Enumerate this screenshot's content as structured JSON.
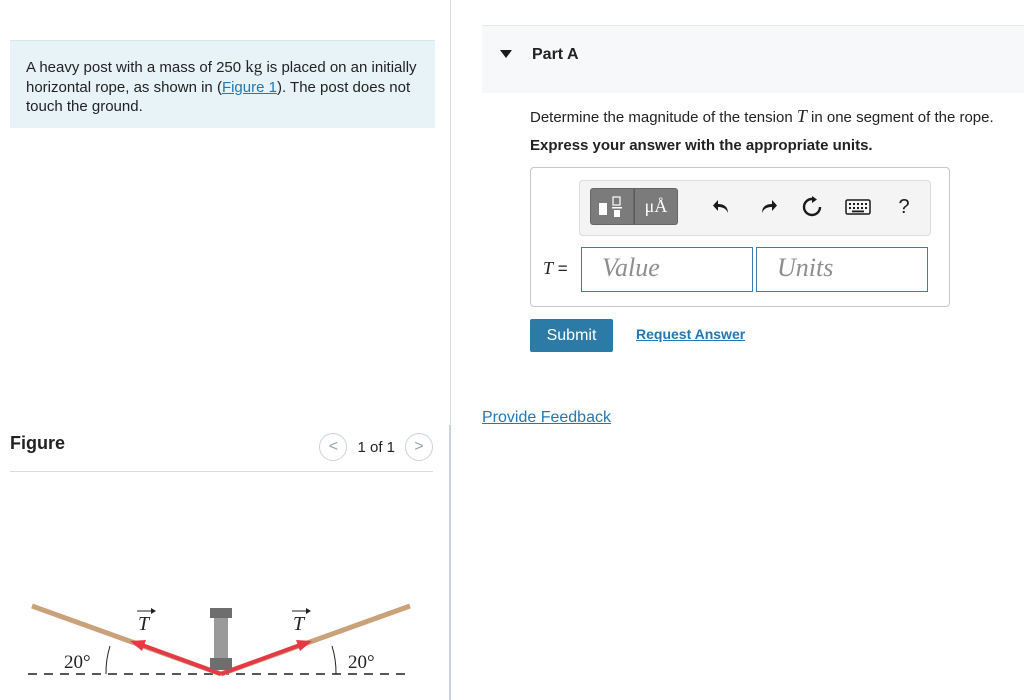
{
  "problem": {
    "text_before_mass": "A heavy post with a mass of 250 ",
    "mass_unit": "kg",
    "text_after_mass": " is placed on an initially horizontal rope, as shown in (",
    "figure_link": "Figure 1",
    "text_end": "). The post does not touch the ground."
  },
  "figure": {
    "title": "Figure",
    "pager_text": "1 of 1",
    "prev_symbol": "<",
    "next_symbol": ">",
    "angle_left": "20°",
    "angle_right": "20°",
    "vector_left": "T",
    "vector_right": "T",
    "colors": {
      "rope": "#c9a27a",
      "vector": "#e63946",
      "post": "#7d7d7d"
    }
  },
  "part": {
    "title": "Part A",
    "question_before": "Determine the magnitude of the tension ",
    "question_symbol": "T",
    "question_after": " in one segment of the rope.",
    "instruction": "Express your answer with the appropriate units."
  },
  "answer": {
    "label_symbol": "T",
    "label_equals": " =",
    "value_placeholder": "Value",
    "units_placeholder": "Units",
    "toolbar": {
      "units_button": "μÅ",
      "help": "?"
    }
  },
  "actions": {
    "submit": "Submit",
    "request_answer": "Request Answer",
    "feedback": "Provide Feedback"
  },
  "colors": {
    "link": "#2377b3",
    "submit_bg": "#2c7ba7",
    "problem_bg": "#e8f3f7"
  }
}
